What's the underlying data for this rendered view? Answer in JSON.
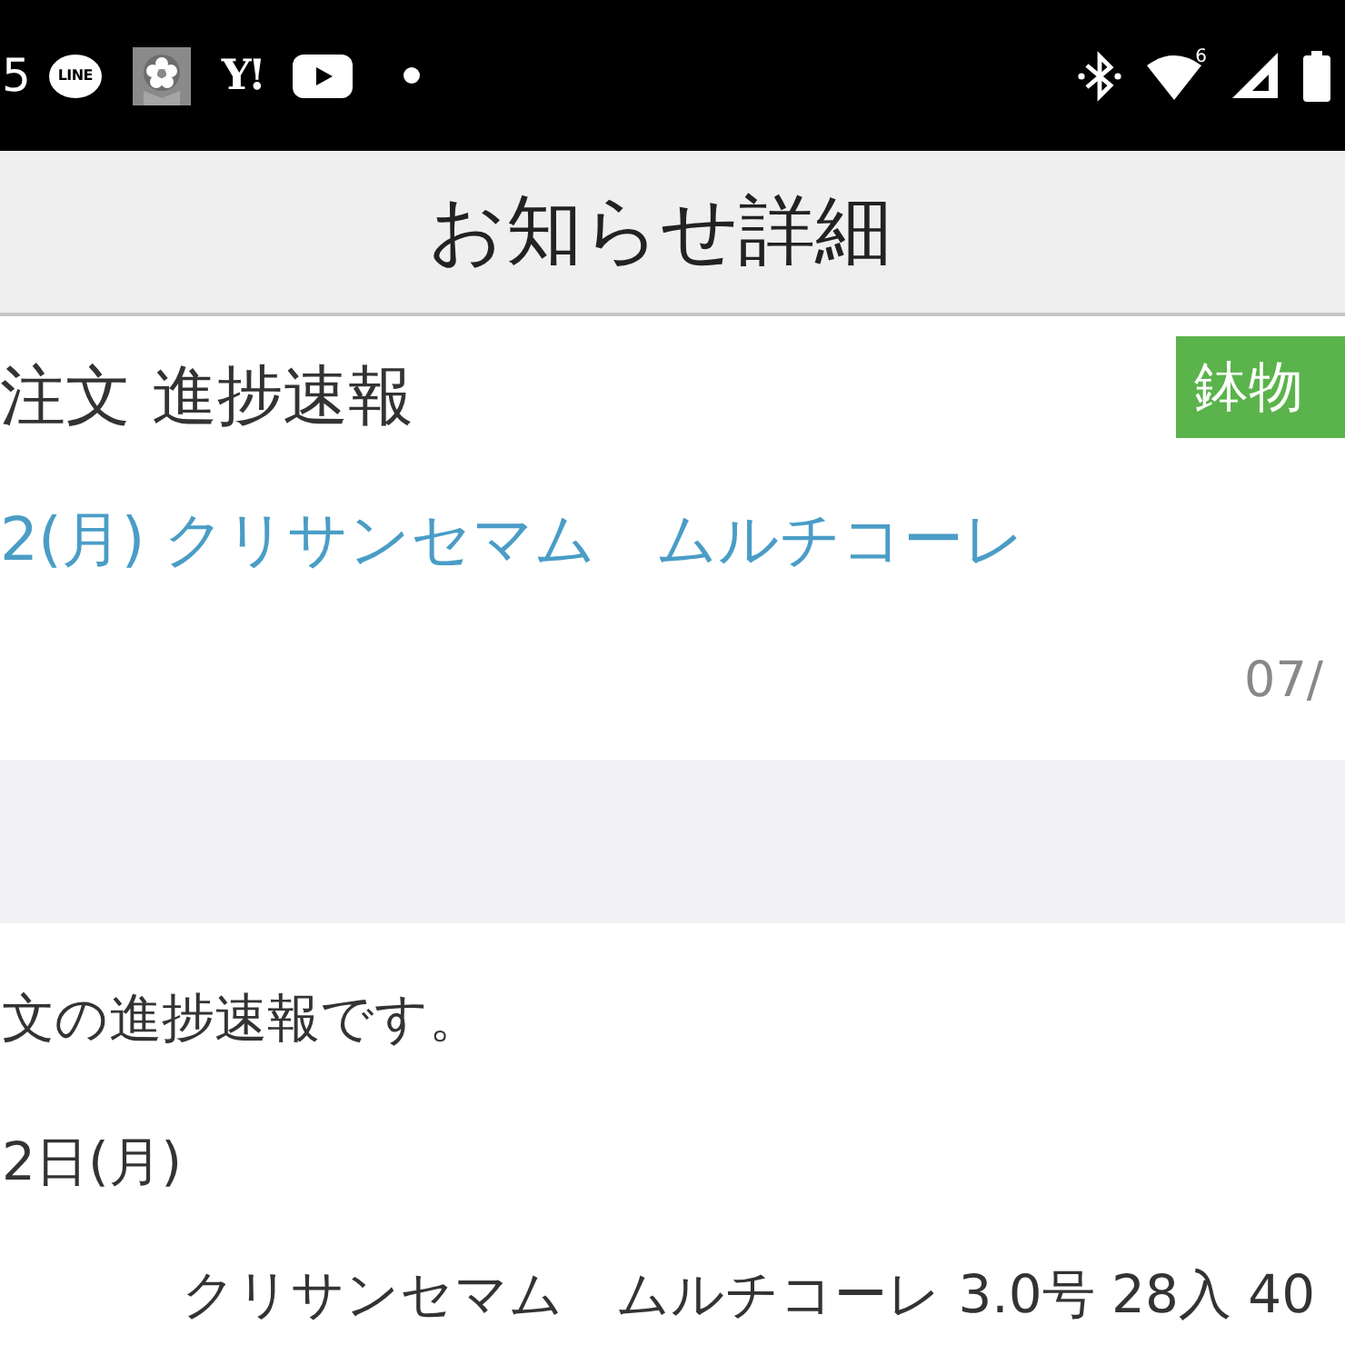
{
  "status_bar": {
    "time": "5",
    "left_icons": [
      {
        "kind": "chat",
        "label": "LINE"
      },
      {
        "kind": "flower_app"
      },
      {
        "kind": "text_logo",
        "label": "Y!"
      },
      {
        "kind": "play"
      },
      {
        "kind": "dot"
      }
    ],
    "right_icons": [
      {
        "kind": "bluetooth"
      },
      {
        "kind": "wifi",
        "label": "6"
      },
      {
        "kind": "signal"
      },
      {
        "kind": "battery"
      }
    ]
  },
  "header": {
    "title": "お知らせ詳細"
  },
  "notice": {
    "title": "注文 進捗速報",
    "category_badge": "鉢物",
    "subject": "2(月) クリサンセマム　ムルチコーレ",
    "date": "07/"
  },
  "body": {
    "lines": [
      "文の進捗速報です。",
      "2日(月)"
    ],
    "item": "クリサンセマム　ムルチコーレ 3.0号 28入 40"
  }
}
